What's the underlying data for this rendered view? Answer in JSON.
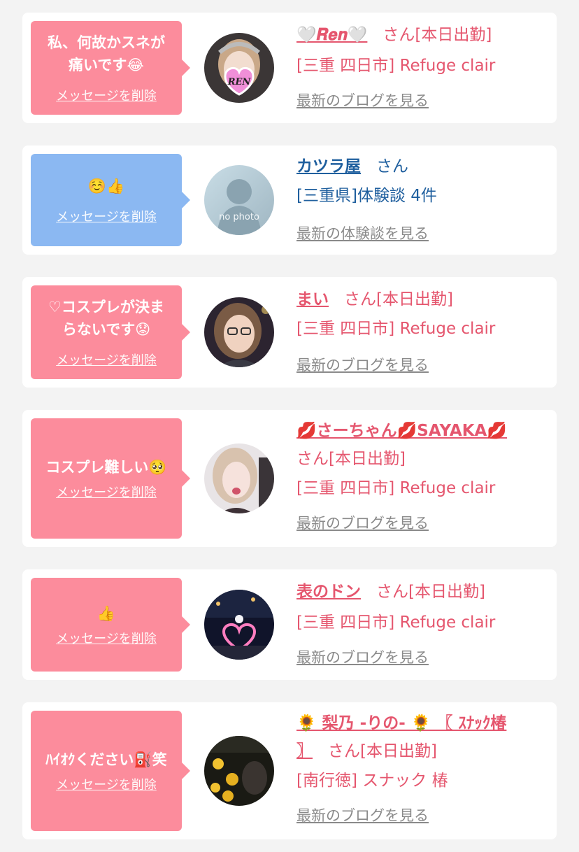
{
  "cards": [
    {
      "message": "私、何故かスネが痛いです😂",
      "delete_label": "メッセージを削除",
      "name": "🤍𝑹𝒆𝒏🤍",
      "san": "さん",
      "status": "[本日出勤]",
      "shop": "[三重 四日市] Refuge clair",
      "link": "最新のブログを見る",
      "avatar_text": "REN"
    },
    {
      "message": "☺️👍",
      "delete_label": "メッセージを削除",
      "name": "カツラ屋",
      "san": "さん",
      "shop": "[三重県]体験談 4件",
      "link": "最新の体験談を見る",
      "avatar_text": "no photo"
    },
    {
      "message": "♡コスプレが決まらないです😟",
      "delete_label": "メッセージを削除",
      "name": "まい",
      "san": "さん",
      "status": "[本日出勤]",
      "shop": "[三重 四日市] Refuge clair",
      "link": "最新のブログを見る"
    },
    {
      "message": "コスプレ難しい🥺",
      "delete_label": "メッセージを削除",
      "name": "💋さーちゃん💋SAYAKA💋",
      "san": "さん",
      "status": "[本日出勤]",
      "shop": "[三重 四日市] Refuge clair",
      "link": "最新のブログを見る"
    },
    {
      "message": "👍",
      "delete_label": "メッセージを削除",
      "name": "表のドン",
      "san": "さん",
      "status": "[本日出勤]",
      "shop": "[三重 四日市] Refuge clair",
      "link": "最新のブログを見る"
    },
    {
      "message": "ﾊｲｵｸください⛽笑",
      "delete_label": "メッセージを削除",
      "name_line1": "🌻 梨乃 -りの- 🌻 〖 ｽﾅｯｸ椿",
      "name_line2": "〗",
      "san": "さん",
      "status": "[本日出勤]",
      "shop": "[南行徳] スナック 椿",
      "link": "最新のブログを見る"
    }
  ],
  "colors": {
    "pink_bubble": "#fc8c9c",
    "blue_bubble": "#8bb8f2",
    "pink_text": "#e5566e",
    "blue_text": "#1f5f9e",
    "link_gray": "#8a8a8a"
  }
}
